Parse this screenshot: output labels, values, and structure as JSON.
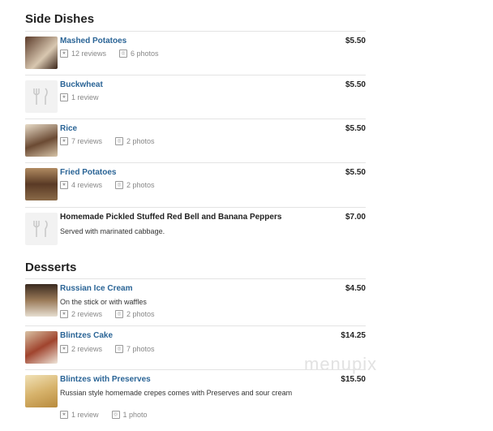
{
  "sections": [
    {
      "title": "Side Dishes"
    },
    {
      "title": "Desserts"
    }
  ],
  "items": [
    {
      "name": "Mashed Potatoes",
      "price": "$5.50",
      "reviews": "12 reviews",
      "photos": "6 photos",
      "thumb": "photo"
    },
    {
      "name": "Buckwheat",
      "price": "$5.50",
      "reviews": "1 review",
      "thumb": "placeholder"
    },
    {
      "name": "Rice",
      "price": "$5.50",
      "reviews": "7 reviews",
      "photos": "2 photos",
      "thumb": "photo"
    },
    {
      "name": "Fried Potatoes",
      "price": "$5.50",
      "reviews": "4 reviews",
      "photos": "2 photos",
      "thumb": "photo"
    },
    {
      "name": "Homemade Pickled Stuffed Red Bell and Banana Peppers",
      "price": "$7.00",
      "description": "Served with marinated cabbage.",
      "thumb": "placeholder"
    },
    {
      "name": "Russian Ice Cream",
      "price": "$4.50",
      "description": "On the stick or with waffles",
      "reviews": "2 reviews",
      "photos": "2 photos",
      "thumb": "photo"
    },
    {
      "name": "Blintzes Cake",
      "price": "$14.25",
      "reviews": "2 reviews",
      "photos": "7 photos",
      "thumb": "photo"
    },
    {
      "name": "Blintzes with Preserves",
      "price": "$15.50",
      "description": "Russian style homemade crepes comes with Preserves and sour cream",
      "reviews": "1 review",
      "photos": "1 photo",
      "thumb": "photo"
    }
  ],
  "watermark": "menupix",
  "icons": {
    "review": "review-icon",
    "photo": "camera-icon",
    "placeholder": "fork-knife-icon"
  }
}
